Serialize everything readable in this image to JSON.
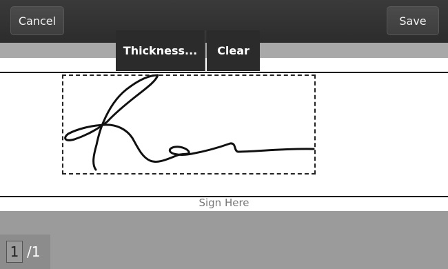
{
  "toolbar": {
    "cancel_label": "Cancel",
    "save_label": "Save"
  },
  "popup_menu": {
    "thickness_label": "Thickness...",
    "clear_label": "Clear"
  },
  "signature_area": {
    "sign_here_label": "Sign Here"
  },
  "pager": {
    "current_page": "1",
    "total_pages": "/1"
  }
}
